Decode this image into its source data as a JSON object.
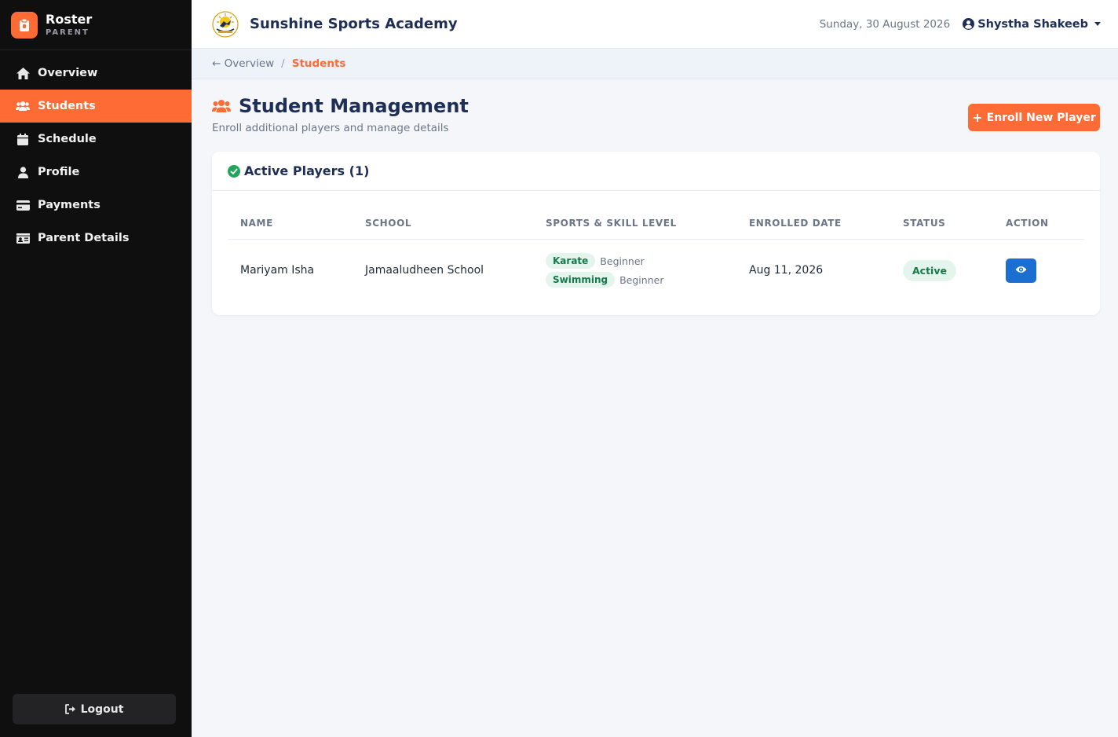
{
  "sidebar": {
    "brand_title": "Roster",
    "brand_sub": "PARENT",
    "items": [
      {
        "label": "Overview",
        "icon": "home-icon"
      },
      {
        "label": "Students",
        "icon": "users-icon",
        "active": true
      },
      {
        "label": "Schedule",
        "icon": "calendar-icon"
      },
      {
        "label": "Profile",
        "icon": "user-icon"
      },
      {
        "label": "Payments",
        "icon": "credit-card-icon"
      },
      {
        "label": "Parent Details",
        "icon": "id-card-icon"
      }
    ],
    "logout_label": "Logout"
  },
  "header": {
    "academy_name": "Sunshine Sports Academy",
    "date": "Sunday, 30 August 2026",
    "user_name": "Shystha Shakeeb"
  },
  "breadcrumb": {
    "back": "← Overview",
    "separator": "/",
    "current": "Students"
  },
  "page": {
    "title": "Student Management",
    "subtitle": "Enroll additional players and manage details",
    "enroll_label": "Enroll New Player"
  },
  "card": {
    "title": "Active Players (1)",
    "columns": [
      "NAME",
      "SCHOOL",
      "SPORTS & SKILL LEVEL",
      "ENROLLED DATE",
      "STATUS",
      "ACTION"
    ],
    "rows": [
      {
        "name": "Mariyam Isha",
        "school": "Jamaaludheen School",
        "sports": [
          {
            "sport": "Karate",
            "level": "Beginner"
          },
          {
            "sport": "Swimming",
            "level": "Beginner"
          }
        ],
        "enrolled": "Aug 11, 2026",
        "status": "Active"
      }
    ]
  },
  "colors": {
    "accent": "#ff6b35",
    "sidebar_bg": "#0f0f10",
    "navy": "#1e2e55",
    "success": "#22a55a",
    "primary_blue": "#1a6fd0"
  }
}
